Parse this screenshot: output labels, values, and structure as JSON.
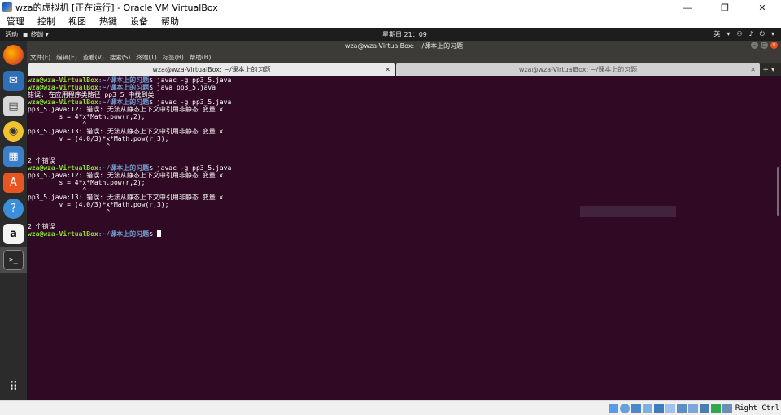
{
  "host": {
    "title": "wza的虚拟机 [正在运行] - Oracle VM VirtualBox",
    "menu": [
      "管理",
      "控制",
      "视图",
      "热键",
      "设备",
      "帮助"
    ],
    "window_buttons": [
      "—",
      "❐",
      "✕"
    ],
    "host_key": "Right Ctrl"
  },
  "gnome": {
    "activities": "活动",
    "app_menu": "终端",
    "clock": "星期日 21：09",
    "input_method": "英"
  },
  "terminal": {
    "title": "wza@wza-VirtualBox: ~/课本上的习题",
    "menu": [
      "文件(F)",
      "编辑(E)",
      "查看(V)",
      "搜索(S)",
      "终端(T)",
      "标签(B)",
      "帮助(H)"
    ],
    "tabs": [
      {
        "label": "wza@wza-VirtualBox: ~/课本上的习题"
      },
      {
        "label": "wza@wza-VirtualBox: ~/课本上的习题"
      }
    ],
    "prompt_user": "wza@wza-VirtualBox",
    "prompt_path": "~/课本上的习题",
    "lines": {
      "cmd1": "$ javac -g pp3_5.java",
      "cmd2": "$ java pp3_5.java",
      "out1": "错误: 在应用程序类路径 pp3_5 中找到类",
      "cmd3": "$ javac -g pp3_5.java",
      "e1": "pp3_5.java:12: 错误: 无法从静态上下文中引用非静态 变量 x",
      "e2": "        s = 4*x*Math.pow(r,2);",
      "e3": "              ^",
      "e4": "pp3_5.java:13: 错误: 无法从静态上下文中引用非静态 变量 x",
      "e5": "        v = (4.0/3)*x*Math.pow(r,3);",
      "e6": "                    ^",
      "e7": "2 个错误",
      "cmd4": "$ javac -g pp3_5.java",
      "f1": "pp3_5.java:12: 错误: 无法从静态上下文中引用非静态 变量 x",
      "f2": "        s = 4*x*Math.pow(r,2);",
      "f3": "              ^",
      "f4": "pp3_5.java:13: 错误: 无法从静态上下文中引用非静态 变量 x",
      "f5": "        v = (4.0/3)*x*Math.pow(r,3);",
      "f6": "                    ^",
      "f7": "2 个错误",
      "last": "$ "
    }
  },
  "colors": {
    "terminal_bg": "#300a24",
    "prompt_user": "#8ae234",
    "prompt_path": "#729fcf",
    "dock_bg": "#2b2b2b"
  }
}
